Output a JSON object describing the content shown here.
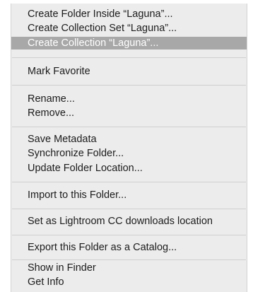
{
  "menu": {
    "items": [
      {
        "label": "Create Folder Inside “Laguna”..."
      },
      {
        "label": "Create Collection Set “Laguna”..."
      },
      {
        "label": "Create Collection “Laguna”...",
        "highlighted": true
      },
      {
        "label": "Mark Favorite"
      },
      {
        "label": "Rename..."
      },
      {
        "label": "Remove..."
      },
      {
        "label": "Save Metadata"
      },
      {
        "label": "Synchronize Folder..."
      },
      {
        "label": "Update Folder Location..."
      },
      {
        "label": "Import to this Folder..."
      },
      {
        "label": "Set as Lightroom CC downloads location"
      },
      {
        "label": "Export this Folder as a Catalog..."
      },
      {
        "label": "Show in Finder"
      },
      {
        "label": "Get Info"
      }
    ]
  }
}
